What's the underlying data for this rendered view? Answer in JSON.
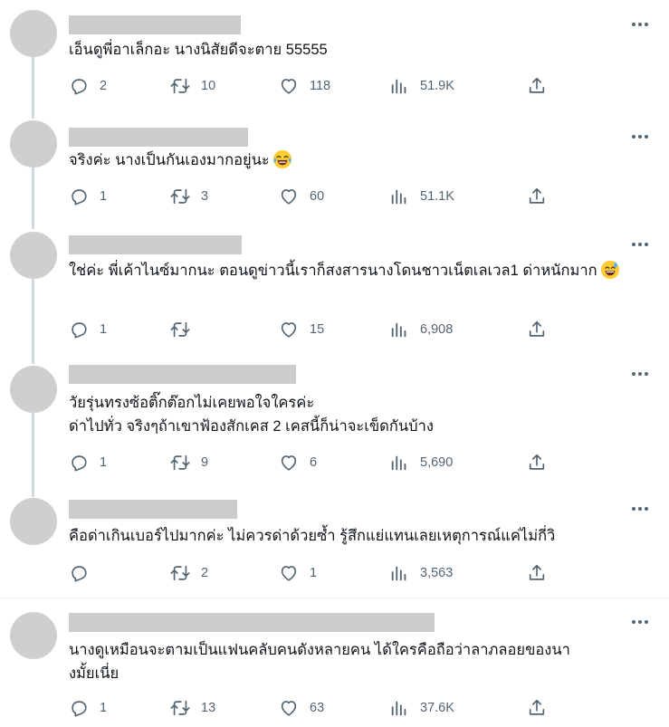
{
  "colors": {
    "avatar": "#cfcfcf",
    "icon": "#536471",
    "text": "#0f1419",
    "redacted": "#cccccc",
    "thread_line": "#cfd9de"
  },
  "icons": {
    "more": "more-dots-icon",
    "reply": "reply-icon",
    "retweet": "retweet-icon",
    "like": "heart-icon",
    "views": "views-icon",
    "share": "share-icon"
  },
  "replies": [
    {
      "text": "เอ็นดูพี่อาเล็กอะ นางนิสัยดีจะตาย 55555",
      "emoji": null,
      "replies": "2",
      "retweets": "10",
      "likes": "118",
      "views": "51.9K"
    },
    {
      "text": "จริงค่ะ  นางเป็นกันเองมากอยู่นะ",
      "emoji": "laughing-tears-emoji",
      "replies": "1",
      "retweets": "3",
      "likes": "60",
      "views": "51.1K"
    },
    {
      "text": "ใช่ค่ะ พี่เค้าไนซ์มากนะ ตอนดูข่าวนี้เราก็สงสารนางโดนชาวเน็ตเลเวล1 ด่าหนักมาก",
      "emoji": "sweat-smile-emoji",
      "replies": "1",
      "retweets": "",
      "likes": "15",
      "views": "6,908"
    },
    {
      "text": "วัยรุ่นทรงซ้อติ๊กต๊อกไม่เคยพอใจใครค่ะ\nด่าไปทั่ว จริงๆถ้าเขาฟ้องสักเคส 2 เคสนี้ก็น่าจะเข็ดกันบ้าง",
      "emoji": null,
      "replies": "1",
      "retweets": "9",
      "likes": "6",
      "views": "5,690"
    },
    {
      "text": "คือด่าเกินเบอร์ไปมากค่ะ ไม่ควรด่าด้วยซ้ำ รู้สึกแย่แทนเลยเหตุการณ์แค่ไม่กี่วิ",
      "emoji": null,
      "replies": "",
      "retweets": "2",
      "likes": "1",
      "views": "3,563"
    },
    {
      "text": "นางดูเหมือนจะตามเป็นแฟนคลับคนดังหลายคน  ได้ใครคือถือว่าลาภลอยของนา\nงมั้ยเนี่ย",
      "emoji": null,
      "replies": "1",
      "retweets": "13",
      "likes": "63",
      "views": "37.6K"
    }
  ]
}
